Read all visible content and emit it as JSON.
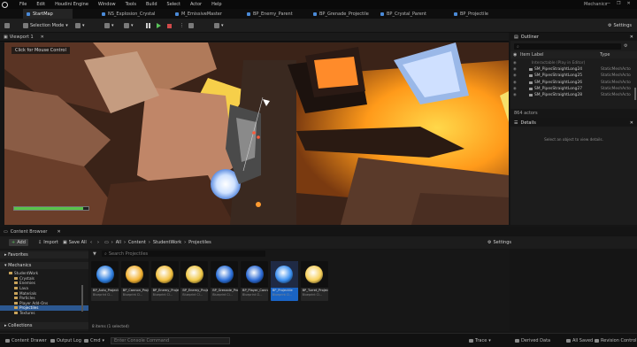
{
  "app": {
    "menu": [
      "File",
      "Edit",
      "Houdini Engine",
      "Window",
      "Tools",
      "Build",
      "Select",
      "Actor",
      "Help"
    ],
    "project_name": "Mechanics",
    "window_controls": [
      "—",
      "❐",
      "✕"
    ]
  },
  "tabs": [
    "StartMap",
    "NS_Explosion_Crystal",
    "M_EmissiveMaster",
    "BP_Enemy_Parent",
    "BP_Grenade_Projectile",
    "BP_Crystal_Parent",
    "BP_Projectile"
  ],
  "toolbar": {
    "selection_mode": "Selection Mode",
    "settings": "Settings"
  },
  "viewport": {
    "tab_label": "Viewport 1",
    "mouse_hint": "Click for Mouse Control",
    "health_fraction": 0.93
  },
  "outliner": {
    "title": "Outliner",
    "col_label": "Item Label",
    "col_type": "Type",
    "rows": [
      {
        "name": "Interactable (Play in Editor)",
        "type": ""
      },
      {
        "name": "SM_PipesStraightLong24",
        "type": "StaticMeshActo"
      },
      {
        "name": "SM_PipesStraightLong25",
        "type": "StaticMeshActo"
      },
      {
        "name": "SM_PipesStraightLong26",
        "type": "StaticMeshActo"
      },
      {
        "name": "SM_PipesStraightLong27",
        "type": "StaticMeshActo"
      },
      {
        "name": "SM_PipesStraightLong28",
        "type": "StaticMeshActo"
      }
    ],
    "footer": "864 actors"
  },
  "details": {
    "title": "Details",
    "empty_text": "Select an object to view details."
  },
  "content_browser": {
    "title": "Content Browser",
    "add": "Add",
    "import": "Import",
    "save_all": "Save All",
    "breadcrumb": [
      "All",
      "Content",
      "StudentWork",
      "Projectiles"
    ],
    "settings": "Settings",
    "search_placeholder": "Search Projectiles",
    "favorites": "Favorites",
    "mechanics": "Mechanics",
    "collections": "Collections",
    "tree": [
      "StudentWork",
      "Crystals",
      "Enemies",
      "Lava",
      "Materials",
      "Particles",
      "Player Add-Ons",
      "Projectiles",
      "Textures"
    ],
    "assets": [
      {
        "label": "BP_Auto_Projectile",
        "sub": "Blueprint Cl...",
        "color": "#2f7fe0"
      },
      {
        "label": "BP_Cannon_Projectile",
        "sub": "Blueprint Cl...",
        "color": "#f2b233"
      },
      {
        "label": "BP_Enemy_Projectile",
        "sub": "Blueprint Cl...",
        "color": "#f2c040"
      },
      {
        "label": "BP_Enemy_Projectile",
        "sub": "Blueprint Cl...",
        "color": "#f0c848"
      },
      {
        "label": "BP_Grenade_Projectile",
        "sub": "Blueprint Cl...",
        "color": "#2b6fd8"
      },
      {
        "label": "BP_Player_Cannon",
        "sub": "Blueprint Cl...",
        "color": "#2b6ad4"
      },
      {
        "label": "BP_Projectile",
        "sub": "Blueprint Cl...",
        "color": "#3a8ff0"
      },
      {
        "label": "BP_Turret_Projectile",
        "sub": "Blueprint Cl...",
        "color": "#f7d05a"
      }
    ],
    "count": "8 items (1 selected)"
  },
  "statusbar": {
    "content_drawer": "Content Drawer",
    "output_log": "Output Log",
    "cmd": "Cmd",
    "console_placeholder": "Enter Console Command",
    "trace": "Trace",
    "derived_data": "Derived Data",
    "all_saved": "All Saved",
    "revision_control": "Revision Control"
  }
}
